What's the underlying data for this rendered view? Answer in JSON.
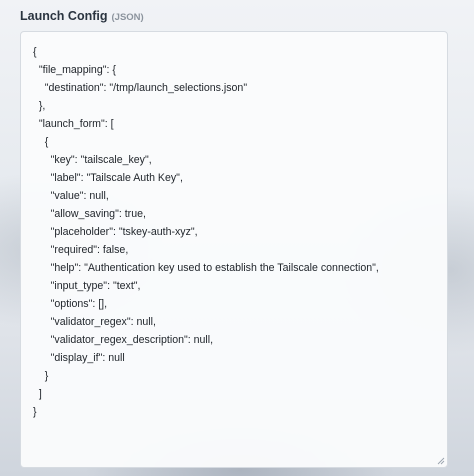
{
  "header": {
    "title": "Launch Config",
    "subtitle": "(JSON)"
  },
  "editor": {
    "lines": [
      "{",
      "  \"file_mapping\": {",
      "    \"destination\": \"/tmp/launch_selections.json\"",
      "  },",
      "  \"launch_form\": [",
      "    {",
      "      \"key\": \"tailscale_key\",",
      "      \"label\": \"Tailscale Auth Key\",",
      "      \"value\": null,",
      "      \"allow_saving\": true,",
      "      \"placeholder\": \"tskey-auth-xyz\",",
      "      \"required\": false,",
      "      \"help\": \"Authentication key used to establish the Tailscale connection\",",
      "      \"input_type\": \"text\",",
      "      \"options\": [],",
      "      \"validator_regex\": null,",
      "      \"validator_regex_description\": null,",
      "      \"display_if\": null",
      "    }",
      "  ]",
      "}"
    ]
  }
}
